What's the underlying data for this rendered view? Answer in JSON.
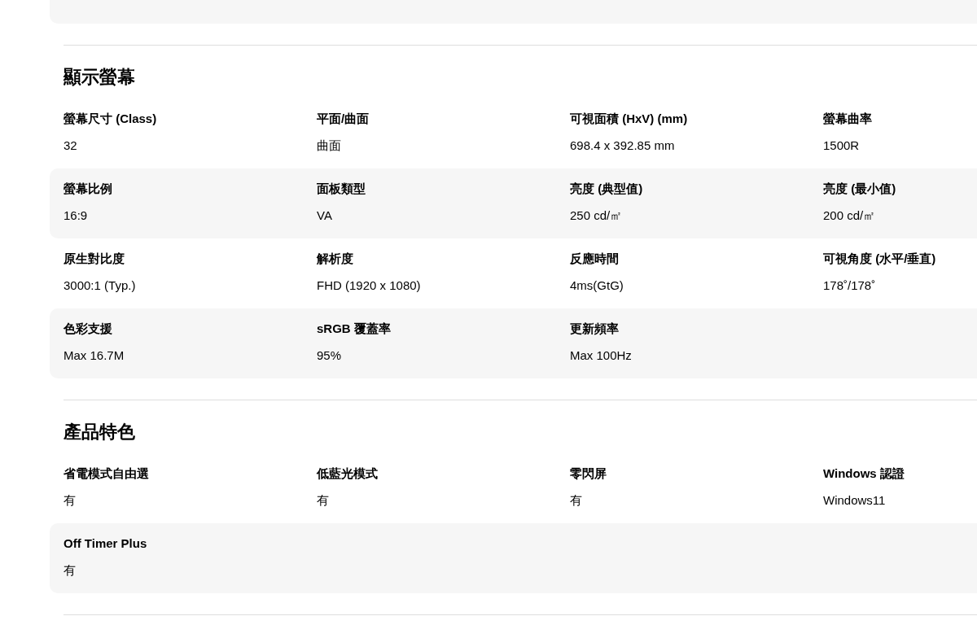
{
  "sections": [
    {
      "title": "顯示螢幕",
      "rows": [
        [
          {
            "label": "螢幕尺寸 (Class)",
            "value": "32"
          },
          {
            "label": "平面/曲面",
            "value": "曲面"
          },
          {
            "label": "可視面積 (HxV) (mm)",
            "value": "698.4 x 392.85 mm"
          },
          {
            "label": "螢幕曲率",
            "value": "1500R"
          }
        ],
        [
          {
            "label": "螢幕比例",
            "value": "16:9"
          },
          {
            "label": "面板類型",
            "value": "VA"
          },
          {
            "label": "亮度 (典型值)",
            "value": "250 cd/㎡"
          },
          {
            "label": "亮度 (最小值)",
            "value": "200 cd/㎡"
          }
        ],
        [
          {
            "label": "原生對比度",
            "value": "3000:1 (Typ.)"
          },
          {
            "label": "解析度",
            "value": "FHD (1920 x 1080)"
          },
          {
            "label": "反應時間",
            "value": "4ms(GtG)"
          },
          {
            "label": "可視角度 (水平/垂直)",
            "value": "178˚/178˚"
          }
        ],
        [
          {
            "label": "色彩支援",
            "value": "Max 16.7M"
          },
          {
            "label": "sRGB 覆蓋率",
            "value": "95%"
          },
          {
            "label": "更新頻率",
            "value": "Max 100Hz"
          }
        ]
      ]
    },
    {
      "title": "產品特色",
      "rows": [
        [
          {
            "label": "省電模式自由選",
            "value": "有"
          },
          {
            "label": "低藍光模式",
            "value": "有"
          },
          {
            "label": "零閃屏",
            "value": "有"
          },
          {
            "label": "Windows 認證",
            "value": "Windows11"
          }
        ],
        [
          {
            "label": "Off Timer Plus",
            "value": "有"
          }
        ]
      ]
    }
  ]
}
